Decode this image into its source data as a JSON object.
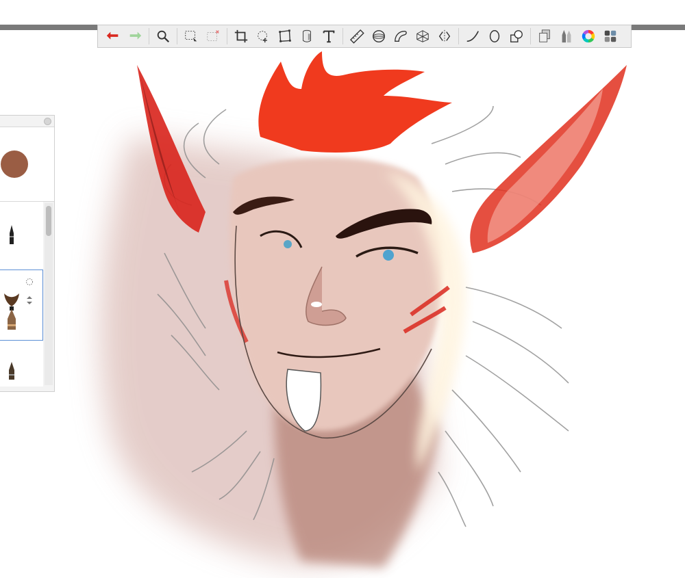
{
  "app": {
    "accent": "#d9281f",
    "panel_color": "#9a5d44"
  },
  "toolbar": {
    "groups": [
      [
        "undo-arrow-icon",
        "redo-arrow-icon"
      ],
      [
        "magnifier-icon"
      ],
      [
        "selection-icon",
        "selection-options-icon"
      ],
      [
        "crop-icon",
        "lasso-fill-icon",
        "transform-icon",
        "fill-bucket-icon",
        "text-icon"
      ],
      [
        "ruler-icon",
        "ellipse-guide-icon",
        "french-curve-icon",
        "perspective-guide-icon",
        "symmetry-icon"
      ],
      [
        "stroke-line-icon",
        "ellipse-shape-icon",
        "shapes-icon"
      ],
      [
        "layers-icon",
        "brush-library-icon",
        "color-wheel-icon",
        "copic-library-icon"
      ]
    ]
  },
  "brush_panel": {
    "selected_color": "#9a5d44",
    "items": [
      "pencil-brush",
      "paint-brush",
      "ink-pen-brush"
    ],
    "selected_index": 1
  }
}
